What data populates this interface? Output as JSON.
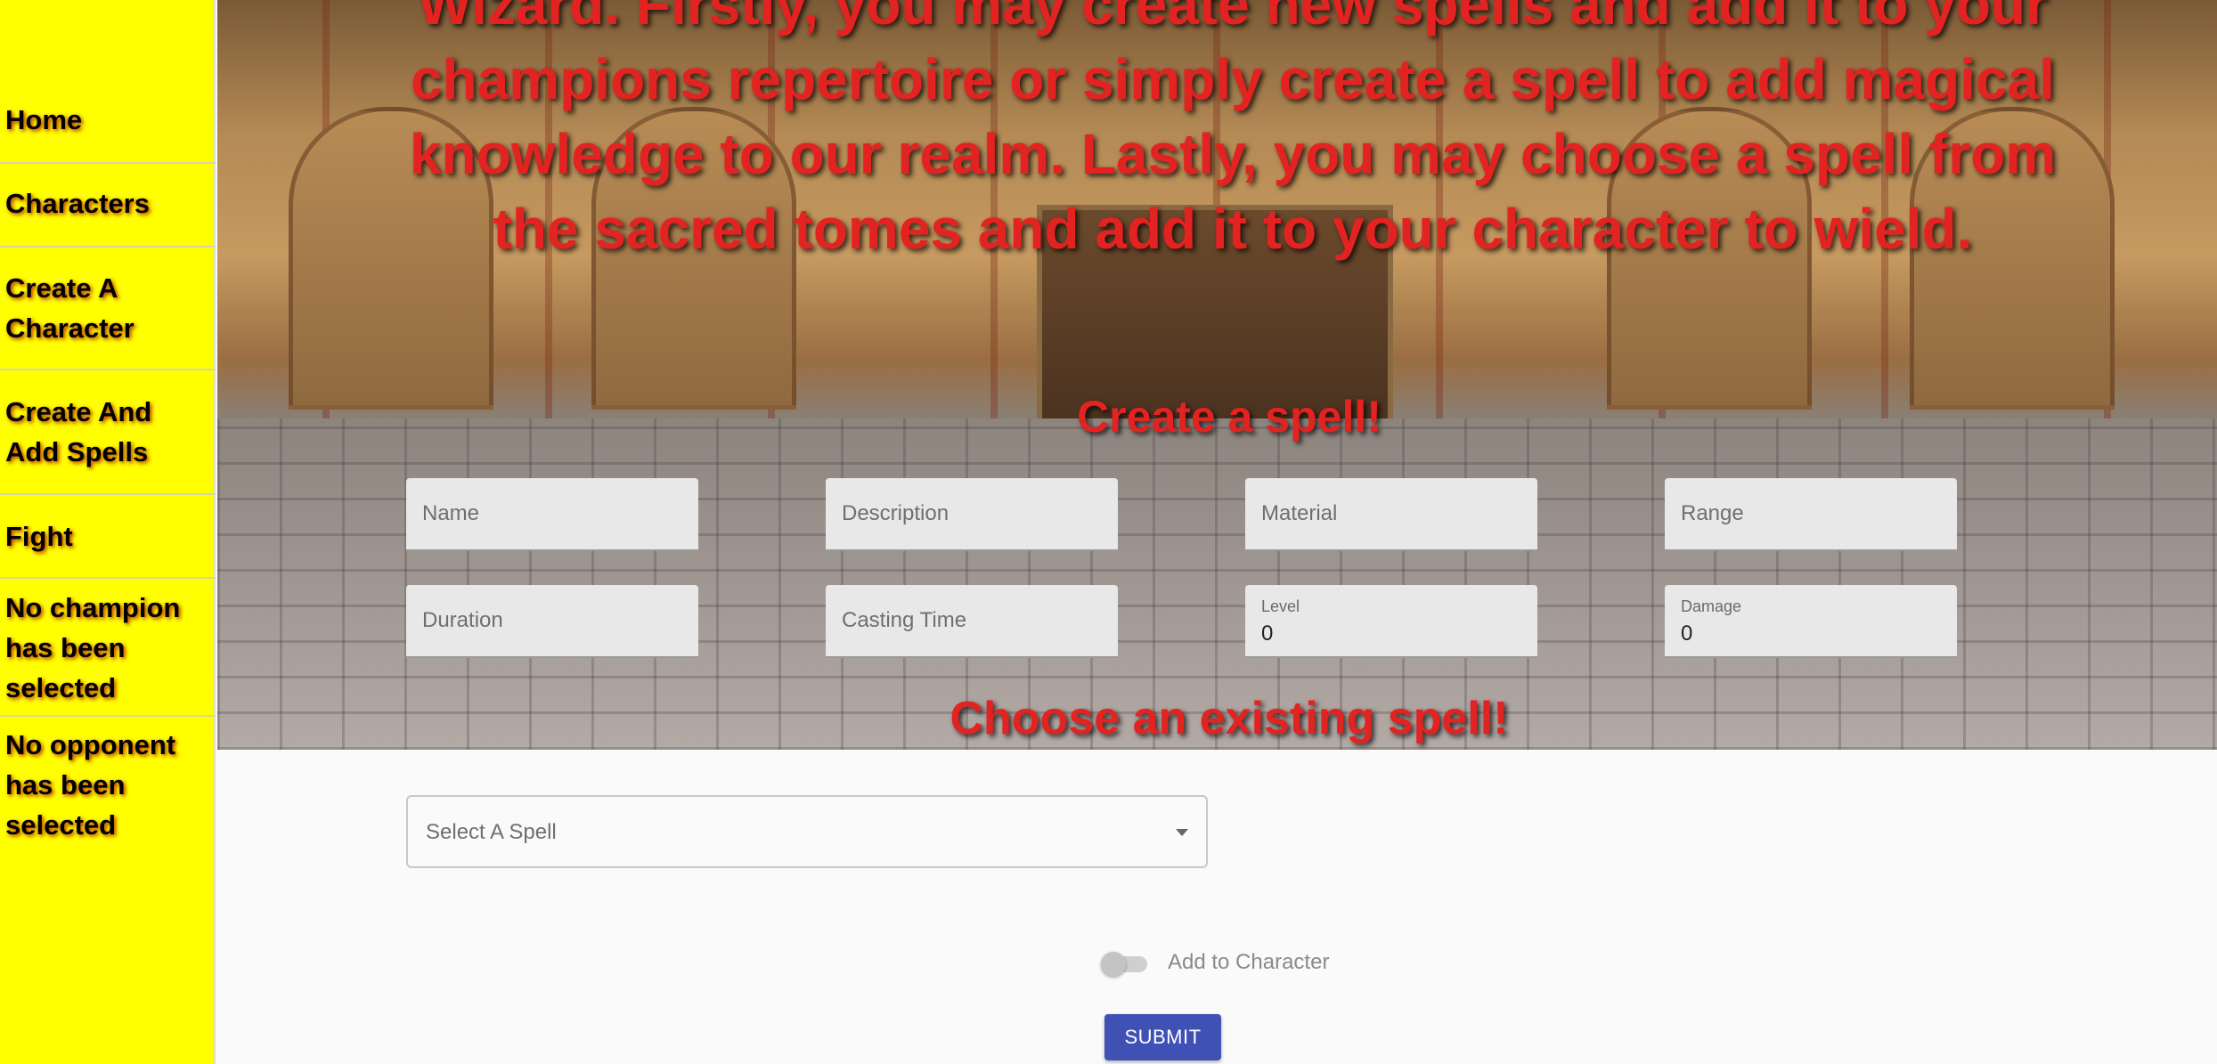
{
  "sidebar": {
    "items": [
      {
        "label": "Home"
      },
      {
        "label": "Characters"
      },
      {
        "label": "Create A Character"
      },
      {
        "label": "Create And Add Spells"
      },
      {
        "label": "Fight"
      },
      {
        "label": "No champion has been selected"
      },
      {
        "label": "No opponent has been selected"
      }
    ]
  },
  "hero": {
    "intro_text": "Wizard. Firstly, you may create new spells and add it to your champions repertoire or simply create a spell to add magical knowledge to our realm. Lastly, you may choose a spell from the sacred tomes and add it to your character to wield."
  },
  "create_spell": {
    "heading": "Create a spell!",
    "fields": {
      "name": {
        "placeholder": "Name"
      },
      "description": {
        "placeholder": "Description"
      },
      "material": {
        "placeholder": "Material"
      },
      "range": {
        "placeholder": "Range"
      },
      "duration": {
        "placeholder": "Duration"
      },
      "casting_time": {
        "placeholder": "Casting Time"
      },
      "level": {
        "label": "Level",
        "value": "0"
      },
      "damage": {
        "label": "Damage",
        "value": "0"
      }
    }
  },
  "existing_spell": {
    "heading": "Choose an existing spell!",
    "select_placeholder": "Select A Spell"
  },
  "add_to_character": {
    "label": "Add to Character",
    "checked": false
  },
  "submit": {
    "label": "SUBMIT"
  },
  "colors": {
    "sidebar_bg": "#ffff00",
    "heading_red": "#e32321",
    "button_primary": "#3f51b5"
  }
}
